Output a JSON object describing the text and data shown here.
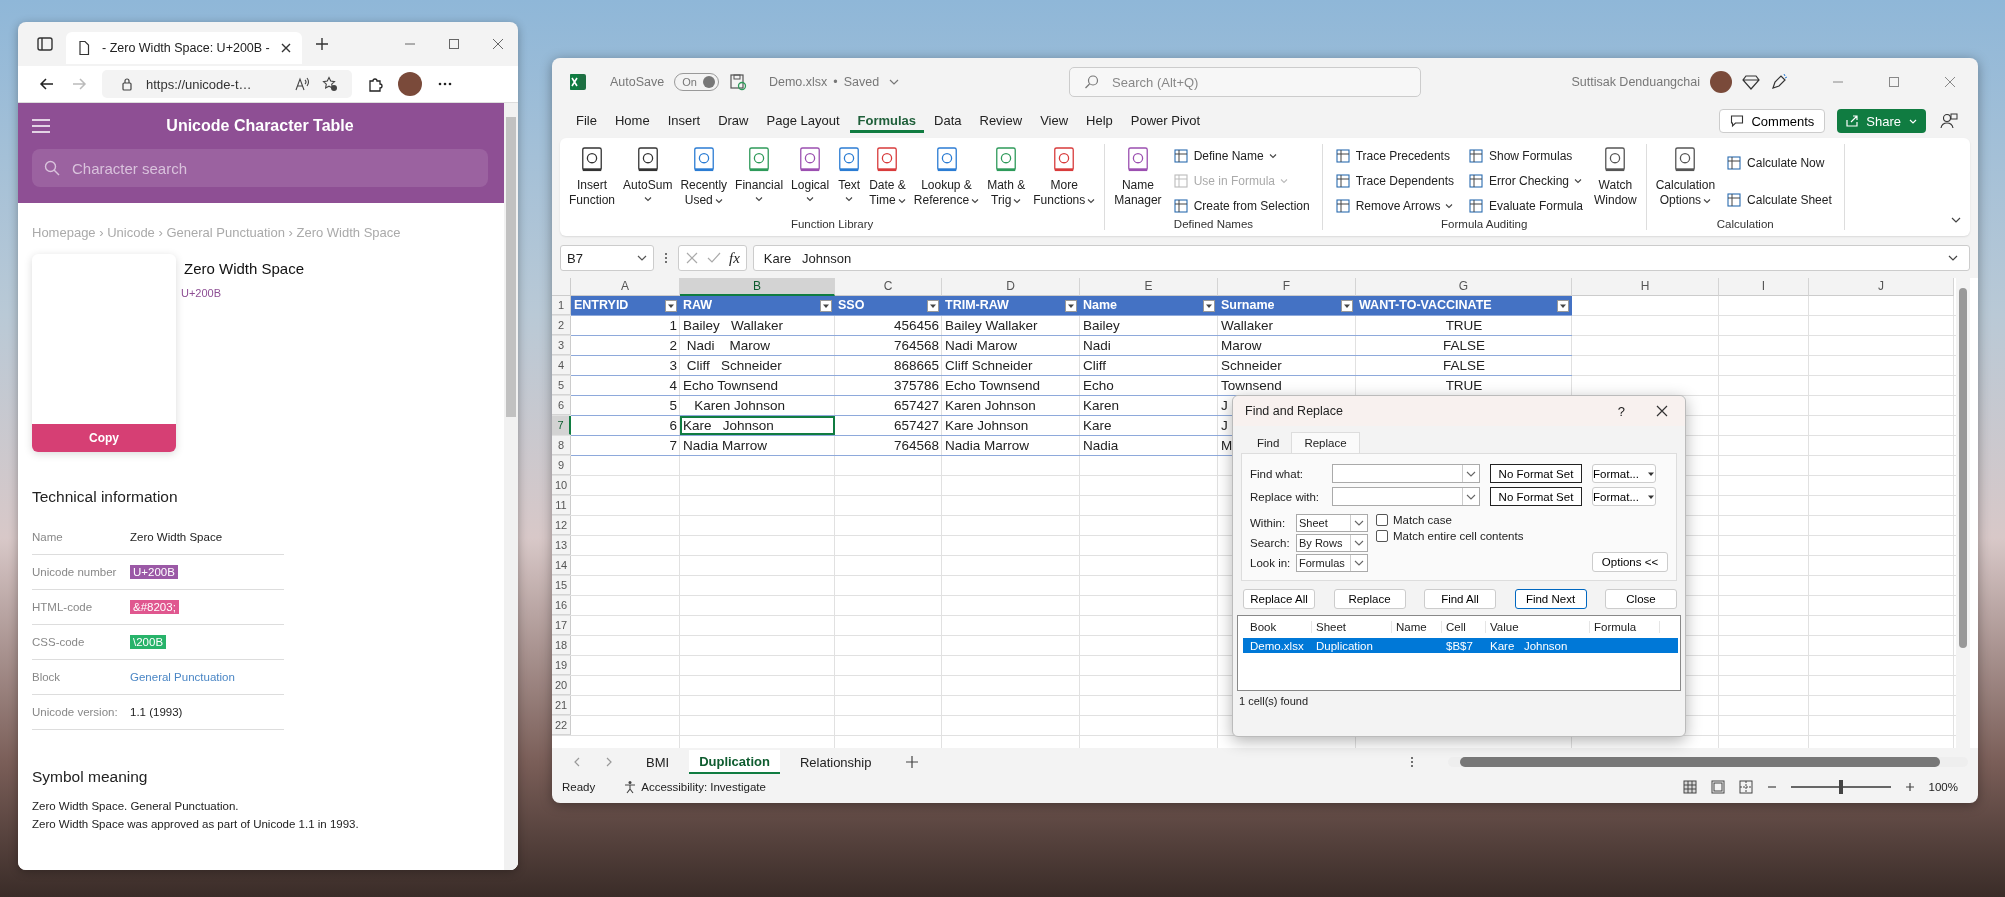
{
  "browser": {
    "tab_title": "- Zero Width Space: U+200B -",
    "url": "https://unicode-t…",
    "site_title": "Unicode Character Table",
    "search": {
      "placeholder": "Character search"
    },
    "breadcrumb": "Homepage › Unicode › General Punctuation › Zero Width Space",
    "character": {
      "name": "Zero Width Space",
      "code": "U+200B",
      "copy_button": "Copy"
    },
    "tech_heading": "Technical information",
    "tech_rows": [
      {
        "label": "Name",
        "value": "Zero Width Space",
        "kind": "plain"
      },
      {
        "label": "Unicode number",
        "value": "U+200B",
        "kind": "badge",
        "color": "#9b59a6"
      },
      {
        "label": "HTML-code",
        "value": "&#8203;",
        "kind": "badge",
        "color": "#e0578f"
      },
      {
        "label": "CSS-code",
        "value": "\\200B",
        "kind": "badge",
        "color": "#27b36a"
      },
      {
        "label": "Block",
        "value": "General Punctuation",
        "kind": "link"
      },
      {
        "label": "Unicode version:",
        "value": "1.1 (1993)",
        "kind": "plain"
      }
    ],
    "meaning_heading": "Symbol meaning",
    "meaning_lines": [
      "Zero Width Space. General Punctuation.",
      "Zero Width Space was approved as part of Unicode 1.1 in 1993."
    ]
  },
  "excel": {
    "autosave": {
      "label": "AutoSave",
      "state_text": "On",
      "on": true
    },
    "file_name": "Demo.xlsx",
    "title_separator": "•",
    "save_status": "Saved",
    "search": {
      "placeholder": "Search (Alt+Q)"
    },
    "user_name": "Suttisak Denduangchai",
    "menu_tabs": [
      {
        "label": "File",
        "selected": false
      },
      {
        "label": "Home",
        "selected": false
      },
      {
        "label": "Insert",
        "selected": false
      },
      {
        "label": "Draw",
        "selected": false
      },
      {
        "label": "Page Layout",
        "selected": false
      },
      {
        "label": "Formulas",
        "selected": true
      },
      {
        "label": "Data",
        "selected": false
      },
      {
        "label": "Review",
        "selected": false
      },
      {
        "label": "View",
        "selected": false
      },
      {
        "label": "Help",
        "selected": false
      },
      {
        "label": "Power Pivot",
        "selected": false
      }
    ],
    "comments_button": "Comments",
    "share_button": "Share",
    "ribbon": [
      {
        "label": "Function Library",
        "items": [
          {
            "kind": "large",
            "lines": [
              "Insert",
              "Function"
            ],
            "dropdown": false
          },
          {
            "kind": "large",
            "lines": [
              "AutoSum"
            ],
            "dropdown": true
          },
          {
            "kind": "large",
            "lines": [
              "Recently",
              "Used"
            ],
            "dropdown": true
          },
          {
            "kind": "large",
            "lines": [
              "Financial"
            ],
            "dropdown": true
          },
          {
            "kind": "large",
            "lines": [
              "Logical"
            ],
            "dropdown": true
          },
          {
            "kind": "large",
            "lines": [
              "Text"
            ],
            "dropdown": true
          },
          {
            "kind": "large",
            "lines": [
              "Date &",
              "Time"
            ],
            "dropdown": true
          },
          {
            "kind": "large",
            "lines": [
              "Lookup &",
              "Reference"
            ],
            "dropdown": true
          },
          {
            "kind": "large",
            "lines": [
              "Math &",
              "Trig"
            ],
            "dropdown": true
          },
          {
            "kind": "large",
            "lines": [
              "More",
              "Functions"
            ],
            "dropdown": true
          }
        ]
      },
      {
        "label": "Defined Names",
        "items": [
          {
            "kind": "large",
            "lines": [
              "Name",
              "Manager"
            ],
            "dropdown": false
          },
          {
            "kind": "stack",
            "items": [
              {
                "label": "Define Name",
                "dropdown": true,
                "disabled": false
              },
              {
                "label": "Use in Formula",
                "dropdown": true,
                "disabled": true
              },
              {
                "label": "Create from Selection",
                "dropdown": false,
                "disabled": false
              }
            ]
          }
        ]
      },
      {
        "label": "Formula Auditing",
        "items": [
          {
            "kind": "stack",
            "items": [
              {
                "label": "Trace Precedents",
                "dropdown": false,
                "disabled": false
              },
              {
                "label": "Trace Dependents",
                "dropdown": false,
                "disabled": false
              },
              {
                "label": "Remove Arrows",
                "dropdown": true,
                "disabled": false
              }
            ]
          },
          {
            "kind": "stack",
            "items": [
              {
                "label": "Show Formulas",
                "dropdown": false,
                "disabled": false
              },
              {
                "label": "Error Checking",
                "dropdown": true,
                "disabled": false
              },
              {
                "label": "Evaluate Formula",
                "dropdown": false,
                "disabled": false
              }
            ]
          },
          {
            "kind": "large",
            "lines": [
              "Watch",
              "Window"
            ],
            "dropdown": false
          }
        ]
      },
      {
        "label": "Calculation",
        "items": [
          {
            "kind": "large",
            "lines": [
              "Calculation",
              "Options"
            ],
            "dropdown": true
          },
          {
            "kind": "stack",
            "items": [
              {
                "label": "Calculate Now",
                "dropdown": false,
                "disabled": false
              },
              {
                "label": "Calculate Sheet",
                "dropdown": false,
                "disabled": false
              }
            ]
          }
        ]
      }
    ],
    "name_box": "B7",
    "fx_label": "fx",
    "formula": "Kare   Johnson",
    "sheet": {
      "columns": [
        {
          "label": "A",
          "selected": false,
          "kind": "number"
        },
        {
          "label": "B",
          "selected": true,
          "kind": "text"
        },
        {
          "label": "C",
          "selected": false,
          "kind": "number"
        },
        {
          "label": "D",
          "selected": false,
          "kind": "text"
        },
        {
          "label": "E",
          "selected": false,
          "kind": "text"
        },
        {
          "label": "F",
          "selected": false,
          "kind": "text"
        },
        {
          "label": "G",
          "selected": false,
          "kind": "boolean"
        },
        {
          "label": "H",
          "selected": false,
          "kind": "plain"
        },
        {
          "label": "I",
          "selected": false,
          "kind": "plain"
        },
        {
          "label": "J",
          "selected": false,
          "kind": "plain"
        }
      ],
      "rows": [
        {
          "label": "1",
          "selected": false,
          "kind": "header",
          "cells": [
            "ENTRYID",
            "RAW",
            "SSO",
            "TRIM-RAW",
            "Name",
            "Surname",
            "WANT-TO-VACCINATE"
          ]
        },
        {
          "label": "2",
          "selected": false,
          "kind": "data",
          "cells": [
            "1",
            "Bailey   Wallaker",
            "456456",
            "Bailey Wallaker",
            "Bailey",
            "Wallaker",
            "TRUE"
          ]
        },
        {
          "label": "3",
          "selected": false,
          "kind": "data",
          "cells": [
            "2",
            " Nadi    Marow",
            "764568",
            "Nadi Marow",
            "Nadi",
            "Marow",
            "FALSE"
          ]
        },
        {
          "label": "4",
          "selected": false,
          "kind": "data",
          "cells": [
            "3",
            " Cliff   Schneider",
            "868665",
            "Cliff Schneider",
            "Cliff",
            "Schneider",
            "FALSE"
          ]
        },
        {
          "label": "5",
          "selected": false,
          "kind": "data",
          "cells": [
            "4",
            "Echo Townsend",
            "375786",
            "Echo Townsend",
            "Echo",
            "Townsend",
            "TRUE"
          ]
        },
        {
          "label": "6",
          "selected": false,
          "kind": "data",
          "cells": [
            "5",
            "   Karen Johnson",
            "657427",
            "Karen Johnson",
            "Karen",
            "J"
          ]
        },
        {
          "label": "7",
          "selected": true,
          "kind": "data",
          "cells": [
            "6",
            "Kare   Johnson",
            "657427",
            "Kare Johnson",
            "Kare",
            "J"
          ]
        },
        {
          "label": "8",
          "selected": false,
          "kind": "data",
          "cells": [
            "7",
            "Nadia Marrow",
            "764568",
            "Nadia Marrow",
            "Nadia",
            "M"
          ]
        },
        {
          "label": "9",
          "selected": false,
          "kind": "empty"
        },
        {
          "label": "10",
          "selected": false,
          "kind": "empty"
        },
        {
          "label": "11",
          "selected": false,
          "kind": "empty"
        },
        {
          "label": "12",
          "selected": false,
          "kind": "empty"
        },
        {
          "label": "13",
          "selected": false,
          "kind": "empty"
        },
        {
          "label": "14",
          "selected": false,
          "kind": "empty"
        },
        {
          "label": "15",
          "selected": false,
          "kind": "empty"
        },
        {
          "label": "16",
          "selected": false,
          "kind": "empty"
        },
        {
          "label": "17",
          "selected": false,
          "kind": "empty"
        },
        {
          "label": "18",
          "selected": false,
          "kind": "empty"
        },
        {
          "label": "19",
          "selected": false,
          "kind": "empty"
        },
        {
          "label": "20",
          "selected": false,
          "kind": "empty"
        },
        {
          "label": "21",
          "selected": false,
          "kind": "empty"
        },
        {
          "label": "22",
          "selected": false,
          "kind": "empty"
        }
      ]
    },
    "sheet_tabs": [
      {
        "label": "BMI",
        "selected": false
      },
      {
        "label": "Duplication",
        "selected": true
      },
      {
        "label": "Relationship",
        "selected": false
      }
    ],
    "status": "Ready",
    "accessibility": "Accessibility: Investigate",
    "zoom": {
      "level": 0.5,
      "label": "100%"
    }
  },
  "dialog": {
    "title": "Find and Replace",
    "help": "?",
    "tabs": [
      {
        "label": "Find",
        "selected": false
      },
      {
        "label": "Replace",
        "selected": true
      }
    ],
    "find_label": "Find what:",
    "replace_label": "Replace with:",
    "no_format": [
      "No Format Set",
      "No Format Set"
    ],
    "format_buttons": [
      "Format...",
      "Format..."
    ],
    "options": [
      {
        "label": "Within:",
        "value": "Sheet"
      },
      {
        "label": "Search:",
        "value": "By Rows"
      },
      {
        "label": "Look in:",
        "value": "Formulas"
      }
    ],
    "checkboxes": [
      {
        "label": "Match case",
        "checked": false
      },
      {
        "label": "Match entire cell contents",
        "checked": false
      }
    ],
    "options_button": "Options <<",
    "buttons": [
      {
        "label": "Replace All",
        "selected": false
      },
      {
        "label": "Replace",
        "selected": false
      },
      {
        "label": "Find All",
        "selected": false
      },
      {
        "label": "Find Next",
        "selected": true
      },
      {
        "label": "Close",
        "selected": false
      }
    ],
    "result_columns": [
      "Book",
      "Sheet",
      "Name",
      "Cell",
      "Value",
      "Formula"
    ],
    "results": [
      {
        "selected": true,
        "cells": [
          "Demo.xlsx",
          "Duplication",
          "",
          "$B$7",
          "Kare   Johnson",
          ""
        ]
      }
    ],
    "found": "1 cell(s) found"
  }
}
